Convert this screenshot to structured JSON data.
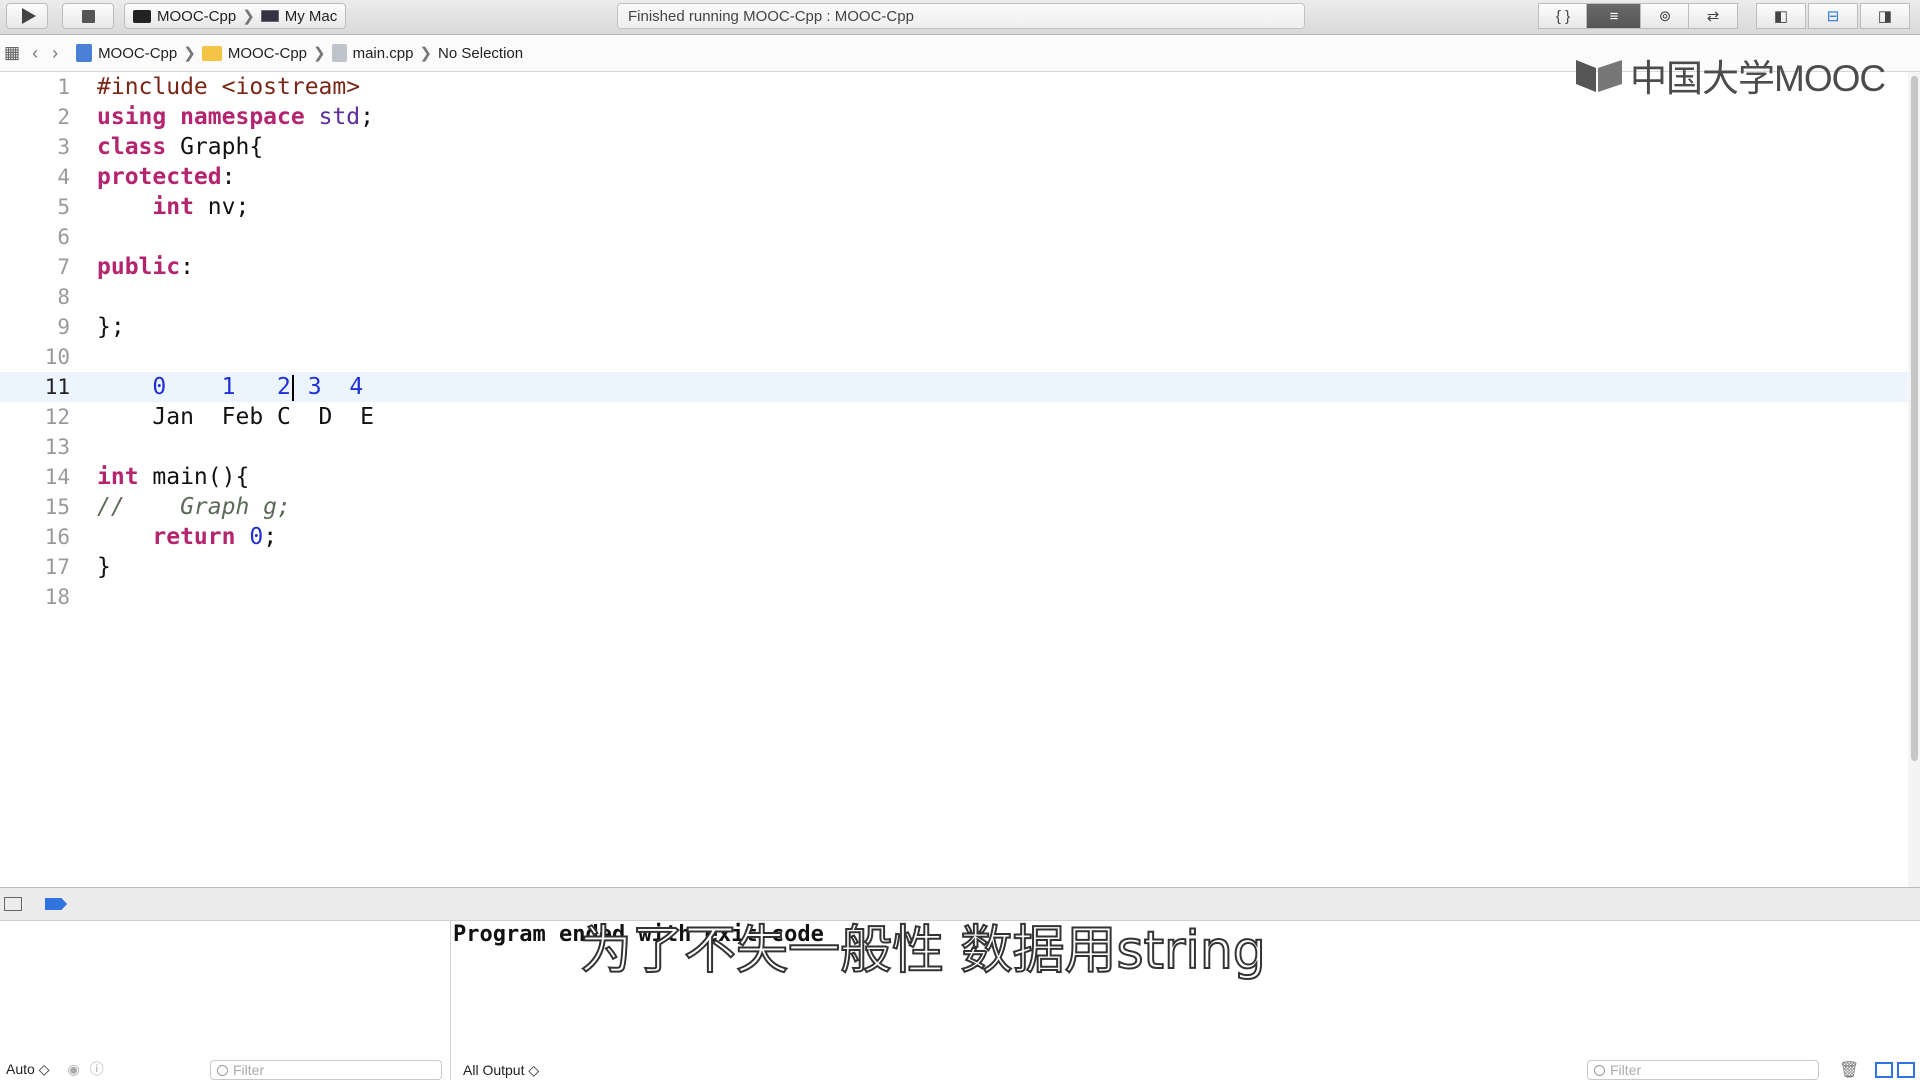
{
  "toolbar": {
    "scheme_project": "MOOC-Cpp",
    "scheme_device": "My Mac",
    "activity_status": "Finished running MOOC-Cpp : MOOC-Cpp",
    "play_icon": "play-icon",
    "stop_icon": "stop-icon",
    "editor_buttons": [
      "{ }",
      "≡",
      "⊚",
      "⇄"
    ],
    "layout_buttons": [
      "◧",
      "⊟",
      "◨"
    ]
  },
  "jumpbar": {
    "project": "MOOC-Cpp",
    "folder": "MOOC-Cpp",
    "file": "main.cpp",
    "selection": "No Selection"
  },
  "logo": {
    "text": "中国大学MOOC"
  },
  "editor": {
    "current_line": 11,
    "line_numbers": [
      "1",
      "2",
      "3",
      "4",
      "5",
      "6",
      "7",
      "8",
      "9",
      "10",
      "11",
      "12",
      "13",
      "14",
      "15",
      "16",
      "17",
      "18"
    ],
    "lines": [
      "#include <iostream>",
      "using namespace std;",
      "class Graph{",
      "protected:",
      "    int nv;",
      "",
      "public:",
      "",
      "};",
      "",
      "    0    1   2  3  4",
      "    Jan  Feb C  D  E",
      "",
      "int main(){",
      "//    Graph g;",
      "    return 0;",
      "}",
      ""
    ]
  },
  "debug": {
    "console_output": "Program ended with exit code",
    "vars_scope": "Auto ◇",
    "filter_placeholder": "Filter",
    "output_scope": "All Output ◇"
  },
  "subtitle": "为了不失一般性 数据用string"
}
